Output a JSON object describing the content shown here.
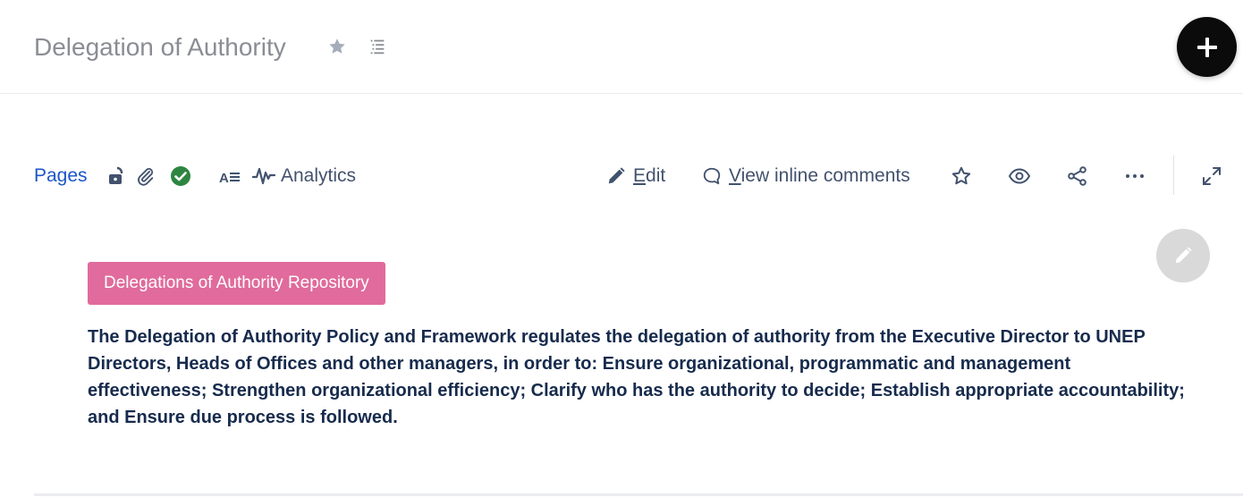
{
  "header": {
    "title": "Delegation of Authority",
    "icons": {
      "star": "star-icon",
      "outline": "outline-list-icon",
      "create": "plus-icon"
    }
  },
  "toolbar": {
    "pages_label": "Pages",
    "status_icons": [
      "unlocked-lock-icon",
      "paperclip-icon",
      "check-circle-icon",
      "text-format-icon"
    ],
    "analytics_label": "Analytics",
    "edit_key": "E",
    "edit_rest": "dit",
    "comments_key": "V",
    "comments_rest": "iew inline comments",
    "right_icons": [
      "star-outline-icon",
      "eye-icon",
      "share-icon",
      "more-icon",
      "fullscreen-icon"
    ]
  },
  "content": {
    "badge_label": "Delegations of Authority Repository",
    "body": "The Delegation of Authority Policy and Framework regulates the delegation of authority from the Executive Director to UNEP Directors, Heads of Offices and other managers, in order to: Ensure organizational, programmatic and management effectiveness; Strengthen organizational efficiency; Clarify who has the authority to decide; Establish appropriate accountability; and Ensure due process is followed."
  },
  "colors": {
    "link": "#1a56c9",
    "badge": "#e06b9c",
    "check": "#2e8540",
    "fab": "#0b0b0b",
    "title_gray": "#8a8d93"
  }
}
